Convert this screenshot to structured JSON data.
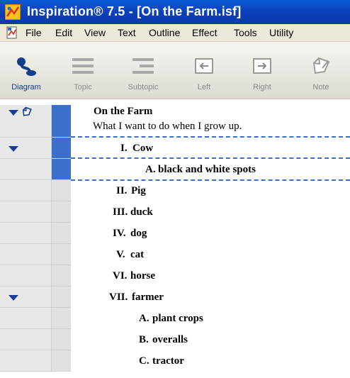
{
  "window": {
    "title": "Inspiration® 7.5 - [On the Farm.isf]"
  },
  "menu": [
    "File",
    "Edit",
    "View",
    "Text",
    "Outline",
    "Effect",
    "Tools",
    "Utility"
  ],
  "toolbar": [
    {
      "label": "Diagram",
      "icon": "diagram-icon",
      "active": true
    },
    {
      "label": "Topic",
      "icon": "topic-icon"
    },
    {
      "label": "Subtopic",
      "icon": "subtopic-icon"
    },
    {
      "label": "Left",
      "icon": "left-arrow-icon"
    },
    {
      "label": "Right",
      "icon": "right-arrow-icon"
    },
    {
      "label": "Note",
      "icon": "note-icon"
    }
  ],
  "outline": {
    "main_idea": "On the Farm",
    "main_note": "What I want to do when I grow up.",
    "items": [
      {
        "num": "I.",
        "text": "Cow"
      },
      {
        "num": "A.",
        "text": "black and white spots"
      },
      {
        "num": "II.",
        "text": "Pig"
      },
      {
        "num": "III.",
        "text": "duck"
      },
      {
        "num": "IV.",
        "text": "dog"
      },
      {
        "num": "V.",
        "text": "cat"
      },
      {
        "num": "VI.",
        "text": "horse"
      },
      {
        "num": "VII.",
        "text": "farmer"
      },
      {
        "num": "A.",
        "text": "plant crops"
      },
      {
        "num": "B.",
        "text": "overalls"
      },
      {
        "num": "C.",
        "text": "tractor"
      }
    ]
  },
  "colors": {
    "titlebar": "#0a4fc6",
    "selection": "#3b6fc9",
    "expand_triangle": "#163d9c"
  }
}
